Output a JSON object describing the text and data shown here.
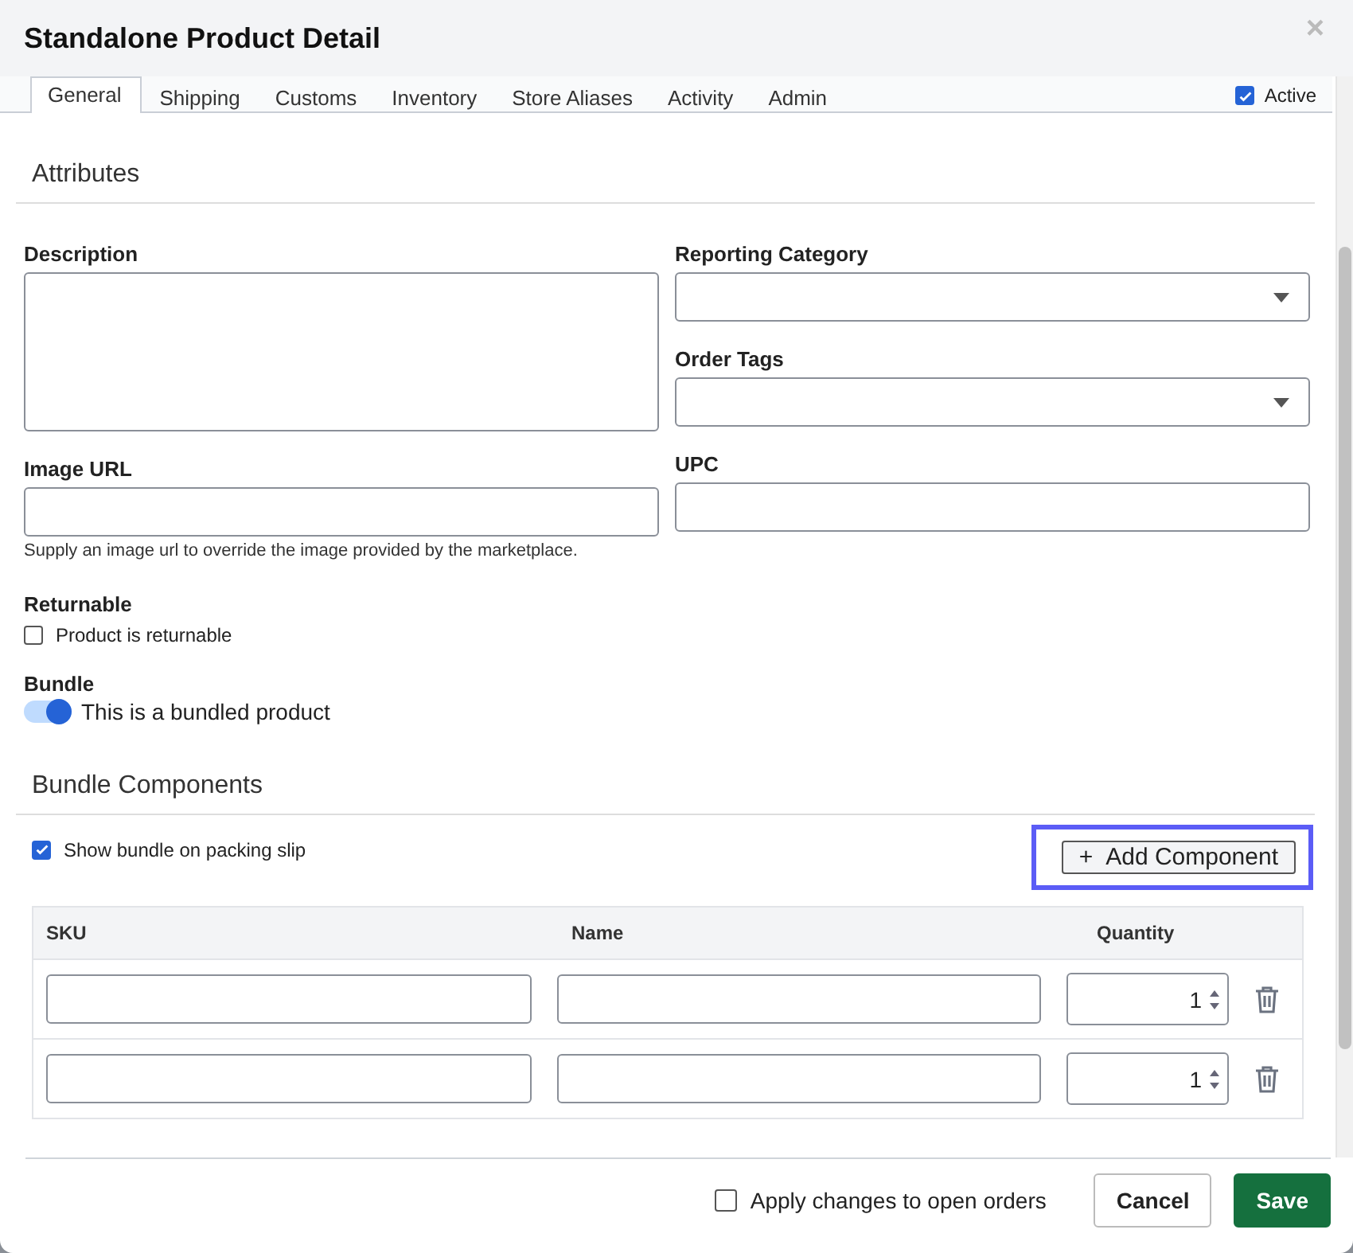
{
  "dialog": {
    "title": "Standalone Product Detail",
    "close": "×"
  },
  "tabs": [
    {
      "label": "General",
      "selected": true
    },
    {
      "label": "Shipping",
      "selected": false
    },
    {
      "label": "Customs",
      "selected": false
    },
    {
      "label": "Inventory",
      "selected": false
    },
    {
      "label": "Store Aliases",
      "selected": false
    },
    {
      "label": "Activity",
      "selected": false
    },
    {
      "label": "Admin",
      "selected": false
    }
  ],
  "active": {
    "label": "Active",
    "checked": true
  },
  "attributes": {
    "heading": "Attributes",
    "left": [
      {
        "kind": "textarea",
        "label": "Description"
      },
      {
        "kind": "input",
        "label": "Image URL",
        "help": "Supply an image url to override the image provided by the marketplace."
      }
    ],
    "right": [
      {
        "kind": "select",
        "label": "Reporting Category"
      },
      {
        "kind": "select",
        "label": "Order Tags"
      },
      {
        "kind": "input",
        "label": "UPC"
      }
    ]
  },
  "returnable": {
    "label": "Returnable",
    "option": "Product is returnable",
    "checked": false
  },
  "bundle": {
    "label": "Bundle",
    "option": "This is a bundled product",
    "on": true
  },
  "bundle_components": {
    "heading": "Bundle Components",
    "show_on_slip": {
      "label": "Show bundle on packing slip",
      "checked": true
    },
    "add_button": {
      "icon": "+",
      "label": "Add Component",
      "highlighted": true
    },
    "columns": [
      "SKU",
      "Name",
      "Quantity"
    ],
    "rows": [
      {
        "quantity": "1"
      },
      {
        "quantity": "1"
      }
    ]
  },
  "footer": {
    "apply_changes": {
      "label": "Apply changes to open orders",
      "checked": false
    },
    "cancel": "Cancel",
    "save": "Save"
  }
}
